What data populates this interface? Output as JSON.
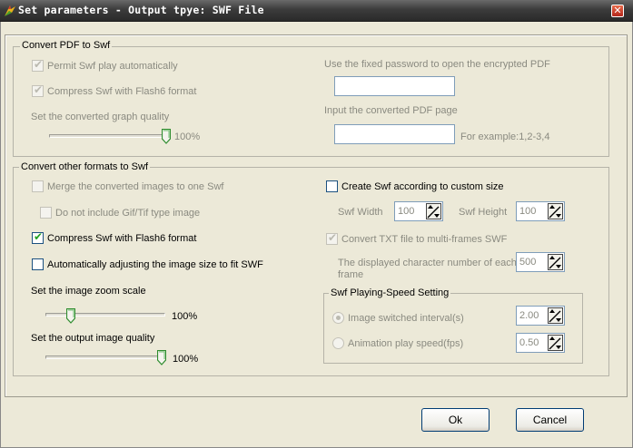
{
  "window": {
    "title": "Set parameters - Output tpye: SWF File",
    "close_glyph": "✕"
  },
  "pdf_group": {
    "legend": "Convert PDF to Swf",
    "permit_autoplay": {
      "label": "Permit Swf play automatically",
      "checked": true,
      "enabled": false
    },
    "compress_flash6": {
      "label": "Compress Swf with Flash6 format",
      "checked": true,
      "enabled": false
    },
    "quality_label": "Set the converted graph quality",
    "quality_value": "100%",
    "quality_level": 1.0,
    "password_label": "Use the fixed password to open the encrypted PDF",
    "password_value": "",
    "page_label": "Input the converted PDF page",
    "page_value": "",
    "page_example": "For example:1,2-3,4"
  },
  "other_group": {
    "legend": "Convert other formats to Swf",
    "merge_images": {
      "label": "Merge the converted images to one Swf",
      "checked": false,
      "enabled": false
    },
    "exclude_gif": {
      "label": "Do not include Gif/Tif type image",
      "checked": false,
      "enabled": false
    },
    "compress_flash6": {
      "label": "Compress Swf with Flash6 format",
      "checked": true,
      "enabled": true
    },
    "auto_adjust": {
      "label": "Automatically adjusting the image size to fit SWF",
      "checked": false,
      "enabled": true
    },
    "zoom_label": "Set the image zoom scale",
    "zoom_value": "100%",
    "zoom_level": 0.2,
    "output_quality_label": "Set the output image quality",
    "output_quality_value": "100%",
    "output_quality_level": 1.0,
    "custom_size": {
      "label": "Create Swf according to custom size",
      "checked": false,
      "enabled": true
    },
    "width_label": "Swf Width",
    "width_value": "100",
    "height_label": "Swf Height",
    "height_value": "100",
    "convert_txt": {
      "label": "Convert TXT file to multi-frames SWF",
      "checked": true,
      "enabled": false
    },
    "char_count_label_1": "The displayed character number of each",
    "char_count_label_2": "frame",
    "char_count_value": "500"
  },
  "speed_group": {
    "legend": "Swf Playing-Speed Setting",
    "interval": {
      "label": "Image switched interval(s)",
      "selected": true,
      "value": "2.00"
    },
    "speed": {
      "label": "Animation play speed(fps)",
      "selected": false,
      "value": "0.50"
    }
  },
  "buttons": {
    "ok": "Ok",
    "cancel": "Cancel"
  },
  "colors": {
    "titlebar": "#3c3c3c",
    "dialog_bg": "#ece9d8",
    "check_tick": "#21a121",
    "slider_thumb": "#2f8d2f"
  }
}
